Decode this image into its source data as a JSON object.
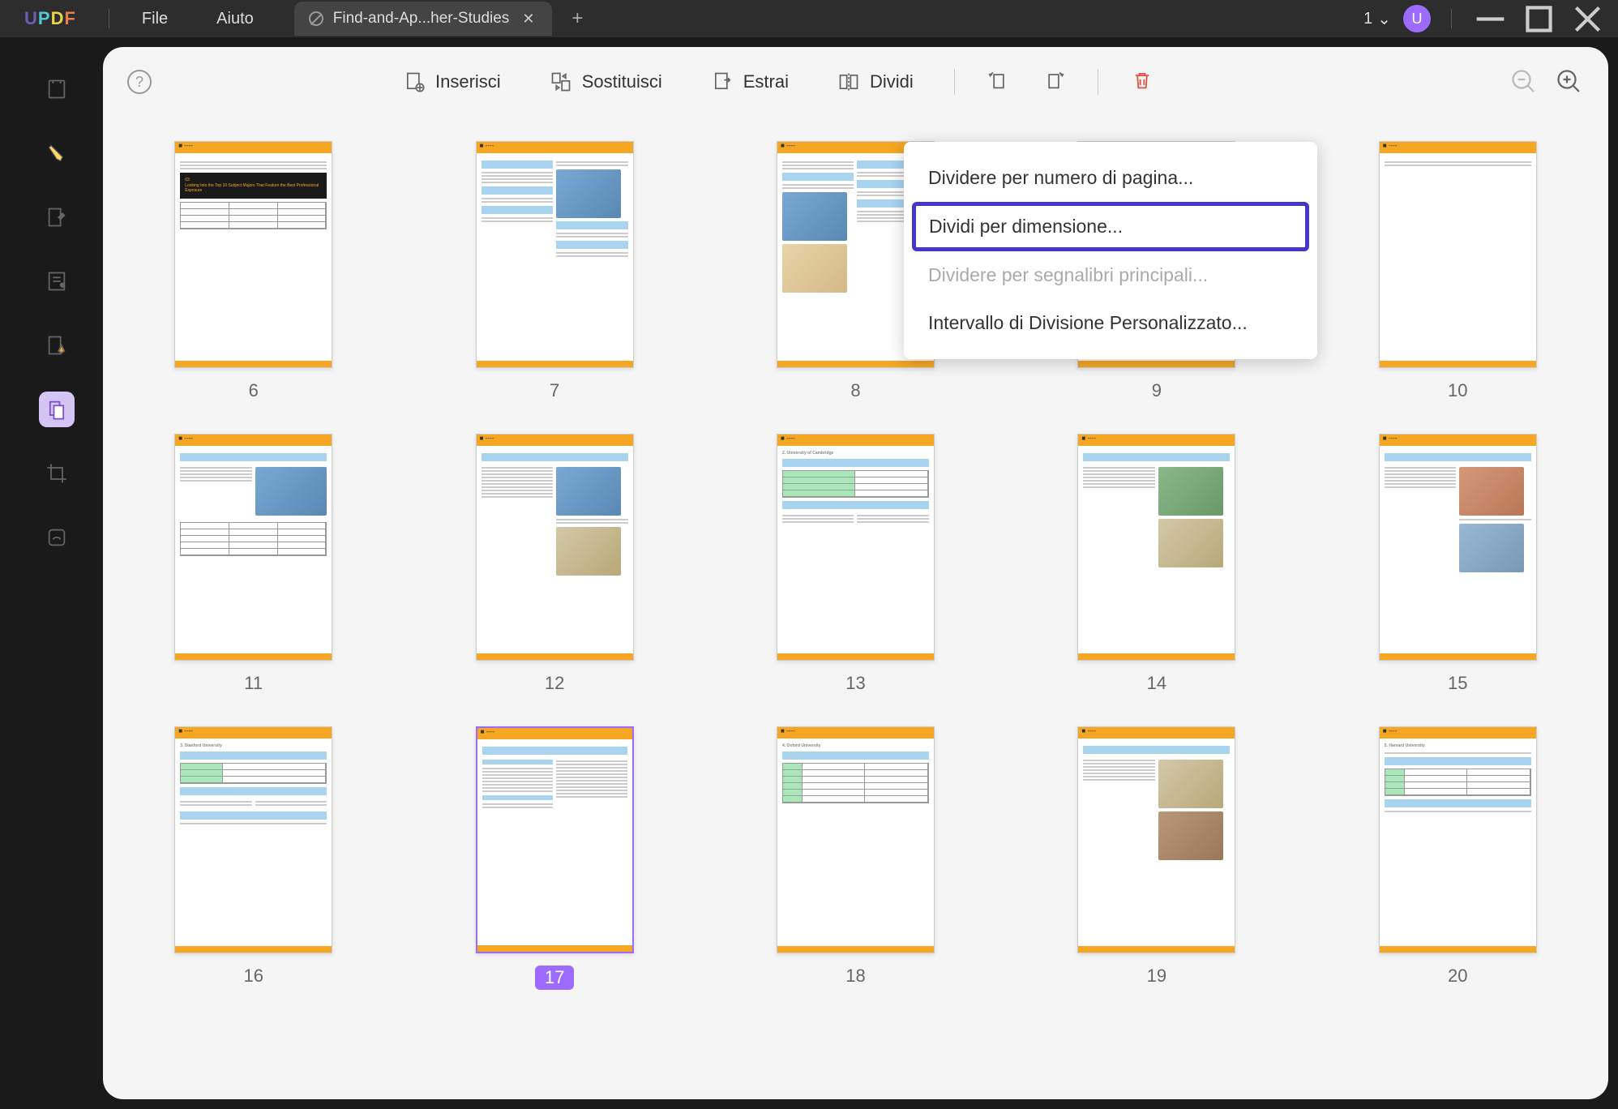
{
  "app": {
    "logo": "UPDF"
  },
  "menu": {
    "file": "File",
    "help": "Aiuto"
  },
  "tab": {
    "title": "Find-and-Ap...her-Studies"
  },
  "titlebar": {
    "doc_count": "1",
    "avatar": "U"
  },
  "toolbar": {
    "insert": "Inserisci",
    "replace": "Sostituisci",
    "extract": "Estrai",
    "split": "Dividi"
  },
  "dropdown": {
    "by_page": "Dividere per numero di pagina...",
    "by_size": "Dividi per dimensione...",
    "by_bookmark": "Dividere per segnalibri principali...",
    "custom": "Intervallo di Divisione Personalizzato..."
  },
  "pages": {
    "p6": "6",
    "p7": "7",
    "p8": "8",
    "p9": "9",
    "p10": "10",
    "p11": "11",
    "p12": "12",
    "p13": "13",
    "p14": "14",
    "p15": "15",
    "p16": "16",
    "p17": "17",
    "p18": "18",
    "p19": "19",
    "p20": "20"
  }
}
